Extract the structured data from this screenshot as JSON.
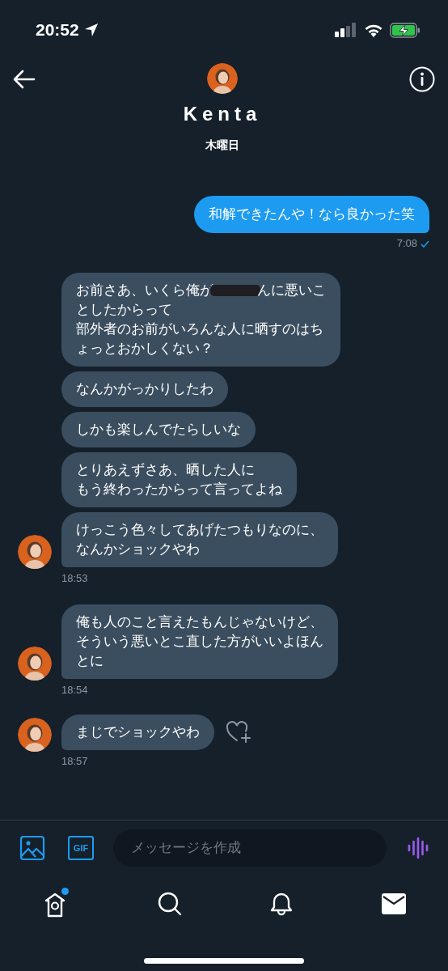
{
  "status_bar": {
    "time": "20:52"
  },
  "header": {
    "name": "Kenta",
    "subtitle": "木曜日"
  },
  "outgoing": {
    "text": "和解できたんや！なら良かった笑",
    "time": "7:08",
    "read": true
  },
  "groups": [
    {
      "messages": [
        {
          "lines": [
            [
              {
                "kind": "text",
                "text": "お前さあ、いくら俺が"
              },
              {
                "kind": "redaction"
              },
              {
                "kind": "text",
                "text": "んに悪いこ"
              }
            ],
            [
              {
                "kind": "text",
                "text": "としたからって"
              }
            ],
            [
              {
                "kind": "text",
                "text": "部外者のお前がいろんな人に晒すのはち"
              }
            ],
            [
              {
                "kind": "text",
                "text": "ょっとおかしくない？"
              }
            ]
          ]
        },
        {
          "lines": [
            [
              {
                "kind": "text",
                "text": "なんかがっかりしたわ"
              }
            ]
          ]
        },
        {
          "lines": [
            [
              {
                "kind": "text",
                "text": "しかも楽しんでたらしいな"
              }
            ]
          ]
        },
        {
          "lines": [
            [
              {
                "kind": "text",
                "text": "とりあえずさあ、晒した人に"
              }
            ],
            [
              {
                "kind": "text",
                "text": "もう終わったからって言ってよね"
              }
            ]
          ]
        },
        {
          "lines": [
            [
              {
                "kind": "text",
                "text": "けっこう色々してあげたつもりなのに、"
              }
            ],
            [
              {
                "kind": "text",
                "text": "なんかショックやわ"
              }
            ]
          ]
        }
      ],
      "time": "18:53",
      "react": false
    },
    {
      "messages": [
        {
          "lines": [
            [
              {
                "kind": "text",
                "text": "俺も人のこと言えたもんじゃないけど、"
              }
            ],
            [
              {
                "kind": "text",
                "text": "そういう悪いとこ直した方がいいよほん"
              }
            ],
            [
              {
                "kind": "text",
                "text": "とに"
              }
            ]
          ]
        }
      ],
      "time": "18:54",
      "react": false
    },
    {
      "messages": [
        {
          "lines": [
            [
              {
                "kind": "text",
                "text": "まじでショックやわ"
              }
            ]
          ]
        }
      ],
      "time": "18:57",
      "react": true
    }
  ],
  "composer": {
    "gif_label": "GIF",
    "placeholder": "メッセージを作成"
  },
  "nav": {
    "home_badge": true
  }
}
